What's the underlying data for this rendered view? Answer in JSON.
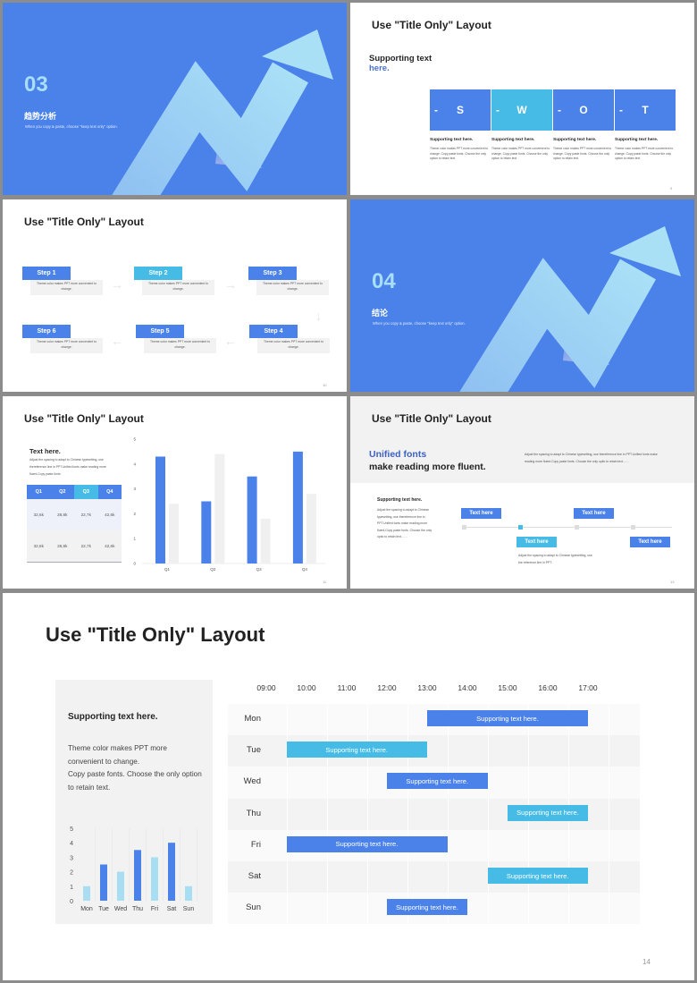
{
  "colors": {
    "primary": "#4b82ea",
    "accent": "#45bbe6",
    "panel": "#f2f2f2"
  },
  "section3": {
    "number": "03",
    "title": "趋势分析",
    "subtitle": "When you copy & paste, choose \"keep text only\" option."
  },
  "section4": {
    "number": "04",
    "title": "结论",
    "subtitle": "When you copy & paste, choose \"keep text only\" option."
  },
  "swot": {
    "title": "Use \"Title Only\" Layout",
    "heading_line1": "Supporting text",
    "heading_line2": "here.",
    "cells": [
      {
        "dash": "-",
        "letter": "S",
        "heading": "Supporting text here.",
        "body": "Theme  color makes PPT more convenient to change. Copy paste  fonts. Choose the only option to retain text."
      },
      {
        "dash": "-",
        "letter": "W",
        "heading": "Supporting text here.",
        "body": "Theme  color makes PPT more convenient to change. Copy paste  fonts. Choose the only option to retain text."
      },
      {
        "dash": "-",
        "letter": "O",
        "heading": "Supporting text here.",
        "body": "Theme  color makes PPT more convenient to change. Copy paste  fonts. Choose the only option to retain text."
      },
      {
        "dash": "-",
        "letter": "T",
        "heading": "Supporting text here.",
        "body": "Theme  color makes PPT more convenient to change. Copy paste  fonts. Choose the only option to retain text."
      }
    ],
    "page": "9"
  },
  "steps": {
    "title": "Use \"Title Only\" Layout",
    "items": [
      {
        "label": "Step 1",
        "text": "Theme color makes PPT more convenient to change."
      },
      {
        "label": "Step 2",
        "text": "Theme color makes PPT more convenient to change."
      },
      {
        "label": "Step 3",
        "text": "Theme color makes PPT more convenient to change."
      },
      {
        "label": "Step 4",
        "text": "Theme color makes PPT more convenient to change."
      },
      {
        "label": "Step 5",
        "text": "Theme color makes PPT more convenient to change."
      },
      {
        "label": "Step 6",
        "text": "Theme color makes PPT more convenient to change."
      }
    ],
    "page": "10"
  },
  "quarters": {
    "title": "Use \"Title Only\" Layout",
    "heading": "Text here.",
    "body": "Adjust the spacing to adapt to Chinese typesetting, use thereference line in PPT.Unified fonts make reading more fluent.Copy paste fonts",
    "table": {
      "headers": [
        "Q1",
        "Q2",
        "Q3",
        "Q4"
      ],
      "rows": [
        [
          "32,6k",
          "28,8k",
          "22,7k",
          "42,6k"
        ],
        [
          "32,6k",
          "28,8k",
          "22,7k",
          "42,6k"
        ]
      ]
    },
    "page": "11"
  },
  "fonts": {
    "title": "Use \"Title Only\" Layout",
    "headline_blue": "Unified fonts",
    "headline_dark": "make reading more fluent.",
    "intro": "Adjust the spacing to adapt to Chinese typesetting, use thereference line in PPT.Unified fonts make reading more fluent.Copy paste fonts. Choose the only optio to retain text……",
    "side_heading": "Supporting text here.",
    "side_body": "Adjust the spacing to adapt to Chinese typesetting, use thereference line in PPT.Unified fonts make reading more fluent.Copy paste fonts. Choose the only optio to retain text……",
    "boxes": [
      "Text here",
      "Text here",
      "Text here",
      "Text here"
    ],
    "caption": "Adjust the spacing to adapt to Chinese typesetting, use the reference line in PPT.",
    "page": "13"
  },
  "schedule": {
    "title": "Use \"Title Only\" Layout",
    "panel_heading": "Supporting text here.",
    "panel_line1": "Theme color makes PPT more",
    "panel_line2": "convenient to change.",
    "panel_line3": "Copy paste fonts. Choose the only option",
    "panel_line4": "to retain text.",
    "times": [
      "09:00",
      "10:00",
      "11:00",
      "12:00",
      "13:00",
      "14:00",
      "15:00",
      "16:00",
      "17:00"
    ],
    "events": [
      {
        "day": "Mon",
        "start": 13,
        "end": 17,
        "label": "Supporting text here.",
        "tone": "primary"
      },
      {
        "day": "Tue",
        "start": 9.5,
        "end": 13,
        "label": "Supporting text here.",
        "tone": "accent"
      },
      {
        "day": "Wed",
        "start": 12,
        "end": 14.5,
        "label": "Supporting text here.",
        "tone": "primary"
      },
      {
        "day": "Thu",
        "start": 15,
        "end": 17,
        "label": "Supporting text here.",
        "tone": "accent"
      },
      {
        "day": "Fri",
        "start": 9.5,
        "end": 13.5,
        "label": "Supporting text here.",
        "tone": "primary"
      },
      {
        "day": "Sat",
        "start": 14.5,
        "end": 17,
        "label": "Supporting text here.",
        "tone": "accent"
      },
      {
        "day": "Sun",
        "start": 12,
        "end": 14,
        "label": "Supporting text here.",
        "tone": "primary"
      }
    ],
    "page": "14"
  },
  "chart_data": [
    {
      "type": "bar",
      "categories": [
        "Q1",
        "Q2",
        "Q3",
        "Q4"
      ],
      "ylim": [
        0,
        5
      ],
      "yticks": [
        "0",
        "1",
        "2",
        "3",
        "4",
        "5"
      ],
      "series": [
        {
          "values": [
            4.3,
            2.5,
            3.5,
            4.5
          ],
          "color": "#4b82ea"
        },
        {
          "values": [
            2.4,
            4.4,
            1.8,
            2.8
          ],
          "color": "#f0f0f0"
        }
      ]
    },
    {
      "type": "bar",
      "categories": [
        "Mon",
        "Tue",
        "Wed",
        "Thu",
        "Fri",
        "Sat",
        "Sun"
      ],
      "ylim": [
        0,
        5
      ],
      "yticks": [
        "0",
        "1",
        "2",
        "3",
        "4",
        "5"
      ],
      "values": [
        1,
        2.5,
        2,
        3.5,
        3,
        4,
        1
      ],
      "colors": [
        "#a8def2",
        "#4b82ea",
        "#a8def2",
        "#4b82ea",
        "#a8def2",
        "#4b82ea",
        "#a8def2"
      ]
    }
  ]
}
